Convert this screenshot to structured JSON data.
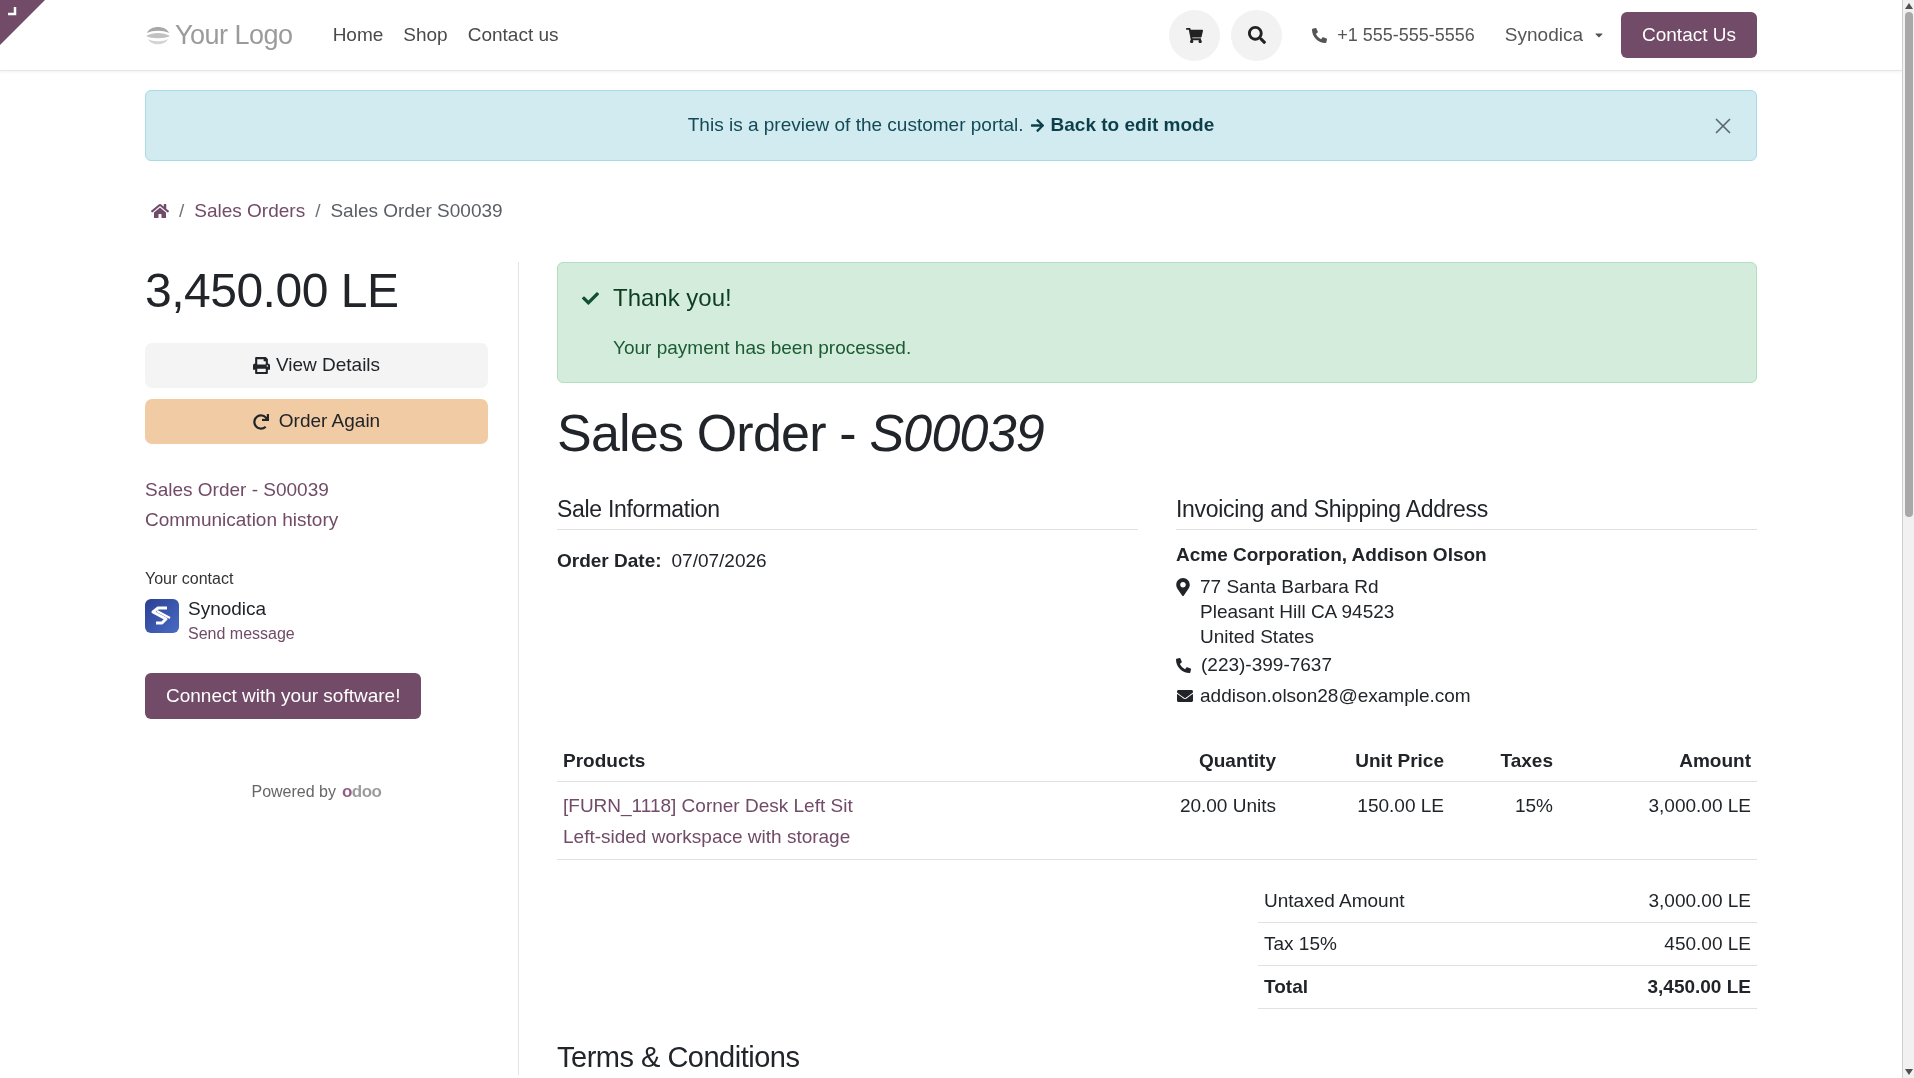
{
  "header": {
    "logo_text": "Your Logo",
    "nav": [
      {
        "label": "Home"
      },
      {
        "label": "Shop"
      },
      {
        "label": "Contact us"
      }
    ],
    "phone": "+1 555-555-5556",
    "user_menu": "Synodica",
    "cta": "Contact Us"
  },
  "preview_banner": {
    "text": "This is a preview of the customer portal.",
    "link": "Back to edit mode"
  },
  "breadcrumb": [
    {
      "kind": "home"
    },
    {
      "kind": "separator",
      "label": "/"
    },
    {
      "kind": "link",
      "label": "Sales Orders"
    },
    {
      "kind": "separator",
      "label": "/"
    },
    {
      "kind": "current",
      "label": "Sales Order S00039"
    }
  ],
  "sidebar": {
    "amount": "3,450.00 LE",
    "actions": [
      {
        "kind": "print",
        "label": "View Details"
      },
      {
        "kind": "reorder",
        "label": "Order Again"
      }
    ],
    "links": [
      "Sales Order - S00039",
      "Communication history"
    ],
    "contact": {
      "heading": "Your contact",
      "name": "Synodica",
      "action": "Send message"
    },
    "connect_button": "Connect with your software!",
    "powered_by": {
      "text": "Powered by",
      "brand": "odoo"
    }
  },
  "payment_alert": {
    "title": "Thank you!",
    "message": "Your payment has been processed."
  },
  "order": {
    "title": "Sales Order - *S00039*",
    "sale_information": {
      "heading": "Sale Information",
      "fields": [
        {
          "label": "Order Date:",
          "value": "07/07/2026"
        }
      ]
    },
    "address": {
      "heading": "Invoicing and Shipping Address",
      "name": "Acme Corporation, Addison Olson",
      "street_lines": [
        "77 Santa Barbara Rd",
        "Pleasant Hill CA 94523",
        "United States"
      ],
      "phone": "(223)-399-7637",
      "email": "addison.olson28@example.com"
    },
    "table": {
      "columns": [
        "Products",
        "Quantity",
        "Unit Price",
        "Taxes",
        "Amount"
      ],
      "rows": [
        {
          "product": "[FURN_1118] Corner Desk Left Sit",
          "description": "Left-sided workspace with storage",
          "quantity": "20.00 Units",
          "unit_price": "150.00 LE",
          "taxes": "15%",
          "amount": "3,000.00 LE"
        }
      ]
    },
    "totals": [
      {
        "kind": "subtotal",
        "label": "Untaxed Amount",
        "value": "3,000.00 LE"
      },
      {
        "kind": "subtotal",
        "label": "Tax 15%",
        "value": "450.00 LE"
      },
      {
        "kind": "total",
        "label": "Total",
        "value": "3,450.00 LE"
      }
    ],
    "terms_heading": "Terms & Conditions"
  }
}
